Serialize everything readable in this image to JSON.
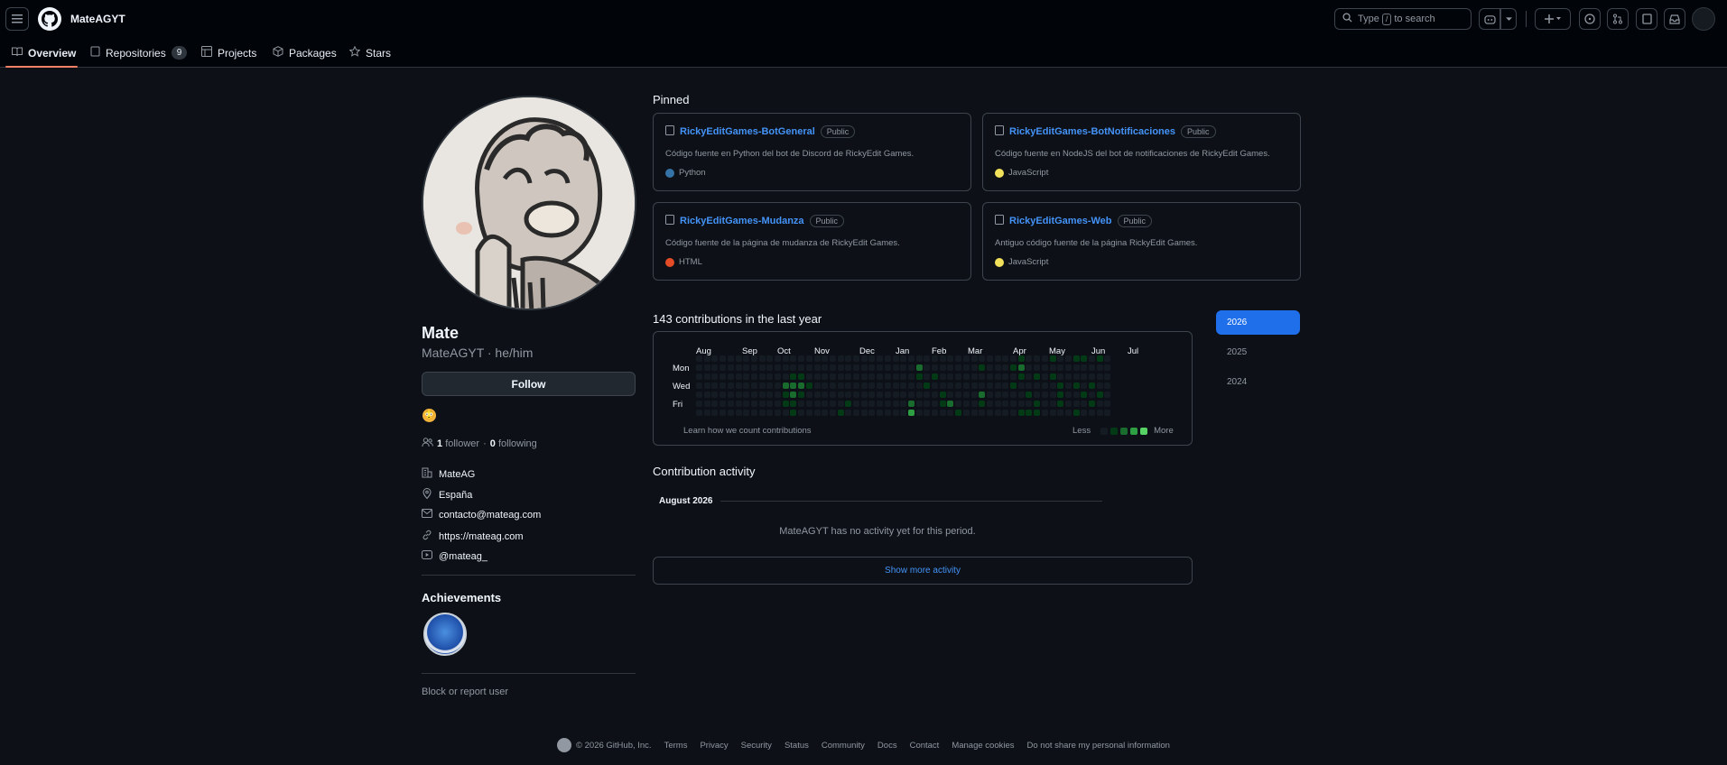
{
  "header": {
    "username": "MateAGYT",
    "search_prefix": "Type",
    "search_key": "/",
    "search_suffix": "to search"
  },
  "tabs": [
    {
      "label": "Overview",
      "icon": "book-icon"
    },
    {
      "label": "Repositories",
      "icon": "repo-icon",
      "count": "9"
    },
    {
      "label": "Projects",
      "icon": "table-icon"
    },
    {
      "label": "Packages",
      "icon": "package-icon"
    },
    {
      "label": "Stars",
      "icon": "star-icon"
    }
  ],
  "profile": {
    "name": "Mate",
    "login_pronouns": "MateAGYT · he/him",
    "follow_label": "Follow",
    "status_emoji": "😳",
    "followers_count": "1",
    "followers_label": "follower",
    "following_count": "0",
    "following_label": "following",
    "separator": "·",
    "organization": "MateAG",
    "location": "España",
    "email": "contacto@mateag.com",
    "website": "https://mateag.com",
    "youtube": "@mateag_"
  },
  "achievements": {
    "title": "Achievements"
  },
  "report_label": "Block or report user",
  "pinned": {
    "title": "Pinned",
    "repos": [
      {
        "name": "RickyEditGames-BotGeneral",
        "visibility": "Public",
        "description": "Código fuente en Python del bot de Discord de RickyEdit Games.",
        "language": "Python",
        "lang_color": "#3572A5"
      },
      {
        "name": "RickyEditGames-BotNotificaciones",
        "visibility": "Public",
        "description": "Código fuente en NodeJS del bot de notificaciones de RickyEdit Games.",
        "language": "JavaScript",
        "lang_color": "#f1e05a"
      },
      {
        "name": "RickyEditGames-Mudanza",
        "visibility": "Public",
        "description": "Código fuente de la página de mudanza de RickyEdit Games.",
        "language": "HTML",
        "lang_color": "#e34c26"
      },
      {
        "name": "RickyEditGames-Web",
        "visibility": "Public",
        "description": "Antiguo código fuente de la página RickyEdit Games.",
        "language": "JavaScript",
        "lang_color": "#f1e05a"
      }
    ]
  },
  "contributions": {
    "title": "143 contributions in the last year",
    "months": [
      "Aug",
      "Sep",
      "Oct",
      "Nov",
      "Dec",
      "Jan",
      "Feb",
      "Mar",
      "Apr",
      "May",
      "Jun",
      "Jul"
    ],
    "days": [
      "Mon",
      "Wed",
      "Fri"
    ],
    "learn_label": "Learn how we count contributions",
    "less_label": "Less",
    "more_label": "More",
    "level_colors": [
      "#151b23",
      "#033a16",
      "#196c2e",
      "#2ea043",
      "#56d364"
    ]
  },
  "years": [
    "2026",
    "2025",
    "2024"
  ],
  "activity": {
    "title": "Contribution activity",
    "month": "August 2026",
    "empty_text": "MateAGYT has no activity yet for this period.",
    "show_more": "Show more activity"
  },
  "footer": {
    "copyright": "© 2026 GitHub, Inc.",
    "links": [
      "Terms",
      "Privacy",
      "Security",
      "Status",
      "Community",
      "Docs",
      "Contact",
      "Manage cookies",
      "Do not share my personal information"
    ]
  }
}
